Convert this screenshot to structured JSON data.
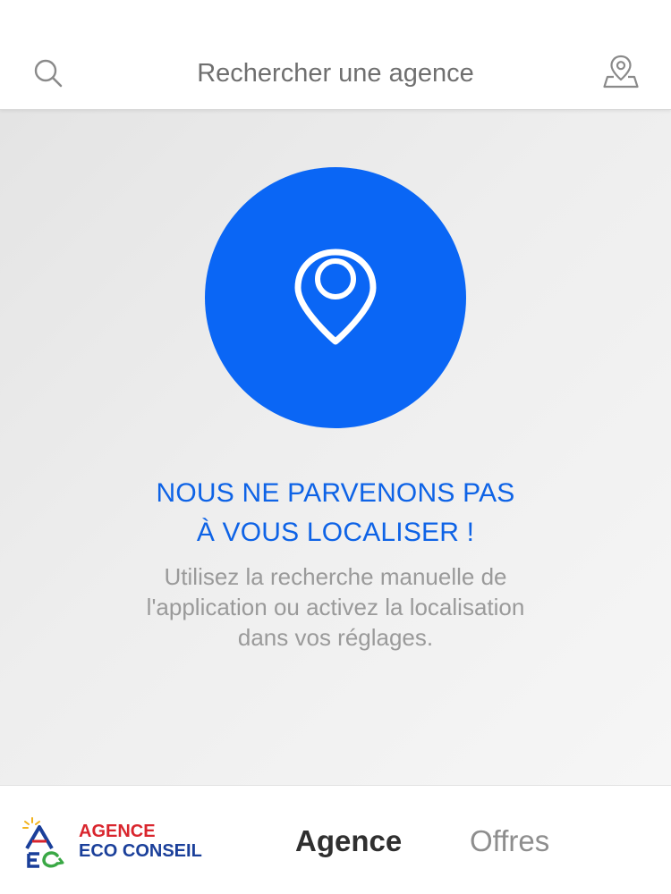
{
  "header": {
    "search_placeholder": "Rechercher une agence",
    "search_icon": "search-icon",
    "map_icon": "map-pin-icon"
  },
  "main": {
    "location_icon": "location-pin-icon",
    "title_line1": "NOUS NE PARVENONS PAS",
    "title_line2": "À VOUS LOCALISER !",
    "description_line1": "Utilisez la recherche manuelle de",
    "description_line2": "l'application ou activez la localisation",
    "description_line3": "dans vos réglages."
  },
  "bottom_nav": {
    "brand_line1": "AGENCE",
    "brand_line2": "ECO CONSEIL",
    "tabs": [
      {
        "label": "Agence",
        "active": true
      },
      {
        "label": "Offres",
        "active": false
      }
    ]
  },
  "colors": {
    "accent": "#0a66f5",
    "title": "#0e63e6",
    "brand_red": "#d9252d",
    "brand_blue": "#1a3f9a",
    "brand_green": "#3aa845"
  }
}
